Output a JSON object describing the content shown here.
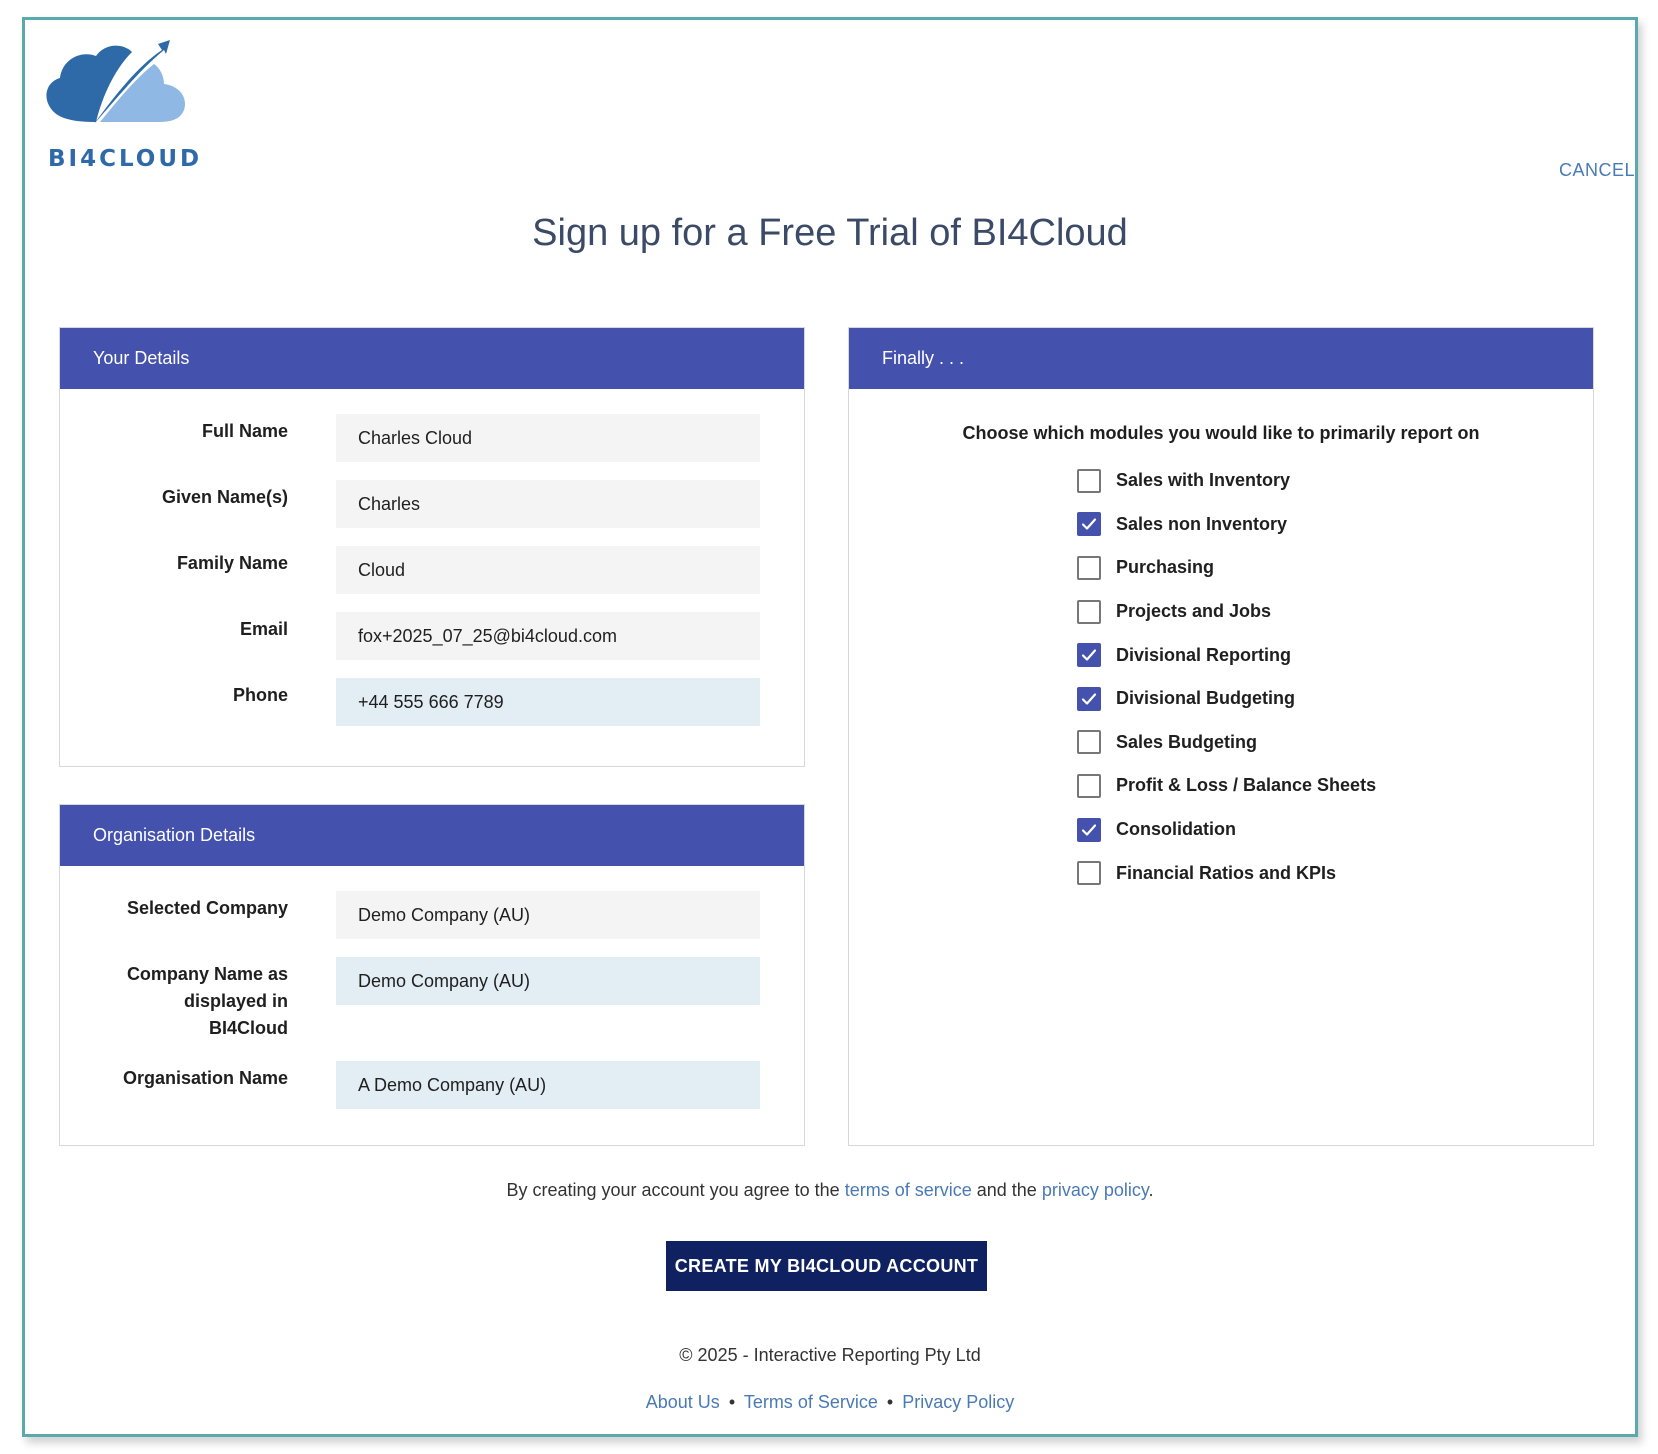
{
  "brand": {
    "name": "BI4CLOUD",
    "primary": "#2f6aa8",
    "secondary": "#8fb8e4"
  },
  "header": {
    "cancel_label": "CANCEL"
  },
  "page": {
    "title": "Sign up for a Free Trial of BI4Cloud"
  },
  "your_details": {
    "heading": "Your Details",
    "fields": [
      {
        "label": "Full Name",
        "value": "Charles Cloud"
      },
      {
        "label": "Given Name(s)",
        "value": "Charles"
      },
      {
        "label": "Family Name",
        "value": "Cloud"
      },
      {
        "label": "Email",
        "value": "fox+2025_07_25@bi4cloud.com"
      },
      {
        "label": "Phone",
        "value": "+44 555 666 7789"
      }
    ]
  },
  "organisation_details": {
    "heading": "Organisation Details",
    "fields": [
      {
        "label": "Selected Company",
        "value": "Demo Company (AU)"
      },
      {
        "label_lines": [
          "Company Name as",
          "displayed in",
          "BI4Cloud"
        ],
        "value": "Demo Company (AU)"
      },
      {
        "label": "Organisation Name",
        "value": "A Demo Company (AU)"
      }
    ]
  },
  "finally": {
    "heading": "Finally . . .",
    "prompt": "Choose which modules you would like to primarily report on",
    "modules": [
      {
        "label": "Sales with Inventory",
        "checked": false
      },
      {
        "label": "Sales non Inventory",
        "checked": true
      },
      {
        "label": "Purchasing",
        "checked": false
      },
      {
        "label": "Projects and Jobs",
        "checked": false
      },
      {
        "label": "Divisional Reporting",
        "checked": true
      },
      {
        "label": "Divisional Budgeting",
        "checked": true
      },
      {
        "label": "Sales Budgeting",
        "checked": false
      },
      {
        "label": "Profit & Loss / Balance Sheets",
        "checked": false
      },
      {
        "label": "Consolidation",
        "checked": true
      },
      {
        "label": "Financial Ratios and KPIs",
        "checked": false
      }
    ]
  },
  "agreement": {
    "prefix": "By creating your account you agree to the",
    "terms_link": "terms of service",
    "middle": "and the",
    "privacy_link": "privacy policy",
    "suffix": "."
  },
  "submit": {
    "label": "CREATE MY BI4CLOUD ACCOUNT"
  },
  "footer": {
    "copyright": "© 2025 - Interactive Reporting Pty Ltd",
    "links": [
      "About Us",
      "Terms of Service",
      "Privacy Policy"
    ],
    "separator": "•"
  },
  "colors": {
    "panel_header": "#4451ad",
    "button": "#0f2160",
    "link": "#4a7ab5",
    "frame_border": "#5aa9ad"
  }
}
